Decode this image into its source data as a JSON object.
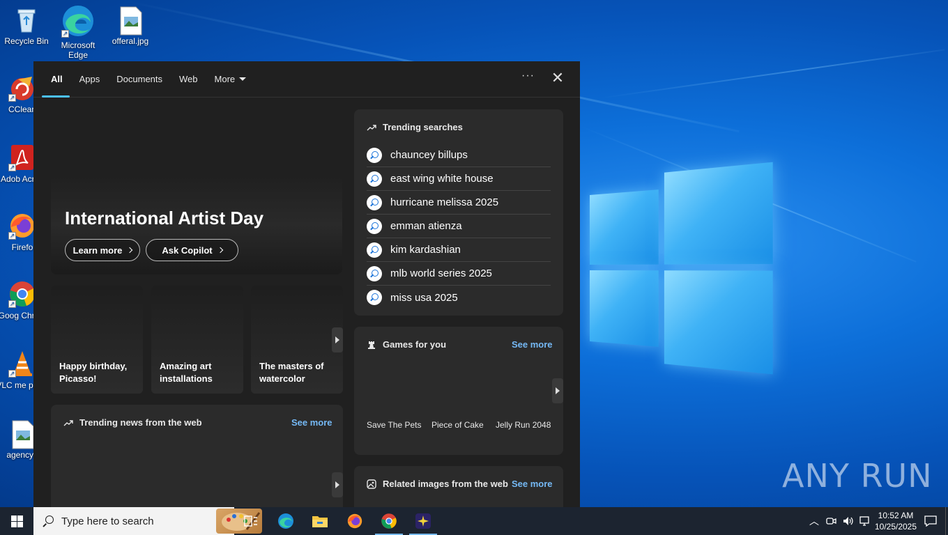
{
  "desktop": {
    "icons": [
      {
        "label": "Recycle Bin"
      },
      {
        "label": "Microsoft Edge"
      },
      {
        "label": "offeral.jpg"
      },
      {
        "label": "CClean"
      },
      {
        "label": "Adob Acrob"
      },
      {
        "label": "Firefo"
      },
      {
        "label": "Goog Chrom"
      },
      {
        "label": "VLC me playe"
      },
      {
        "label": "agencyo"
      }
    ],
    "watermark": "ANY RUN"
  },
  "search_panel": {
    "tabs": [
      "All",
      "Apps",
      "Documents",
      "Web",
      "More"
    ],
    "active_tab": "All",
    "hero": {
      "title": "International Artist Day",
      "learn_more": "Learn more",
      "ask_copilot": "Ask Copilot"
    },
    "stories": [
      "Happy birthday, Picasso!",
      "Amazing art installations",
      "The masters of watercolor"
    ],
    "news": {
      "title": "Trending news from the web",
      "see_more": "See more"
    },
    "trending": {
      "title": "Trending searches",
      "items": [
        "chauncey billups",
        "east wing white house",
        "hurricane melissa 2025",
        "emman atienza",
        "kim kardashian",
        "mlb world series 2025",
        "miss usa 2025"
      ]
    },
    "games": {
      "title": "Games for you",
      "see_more": "See more",
      "items": [
        "Save The Pets",
        "Piece of Cake",
        "Jelly Run 2048"
      ]
    },
    "related": {
      "title": "Related images from the web",
      "see_more": "See more"
    }
  },
  "taskbar": {
    "search_placeholder": "Type here to search",
    "time": "10:52 AM",
    "date": "10/25/2025"
  },
  "colors": {
    "accent": "#4cc2ff",
    "link": "#75b9f5",
    "panel_bg": "#202020",
    "card_bg": "#2b2b2b",
    "taskbar_bg": "#1c2430"
  }
}
